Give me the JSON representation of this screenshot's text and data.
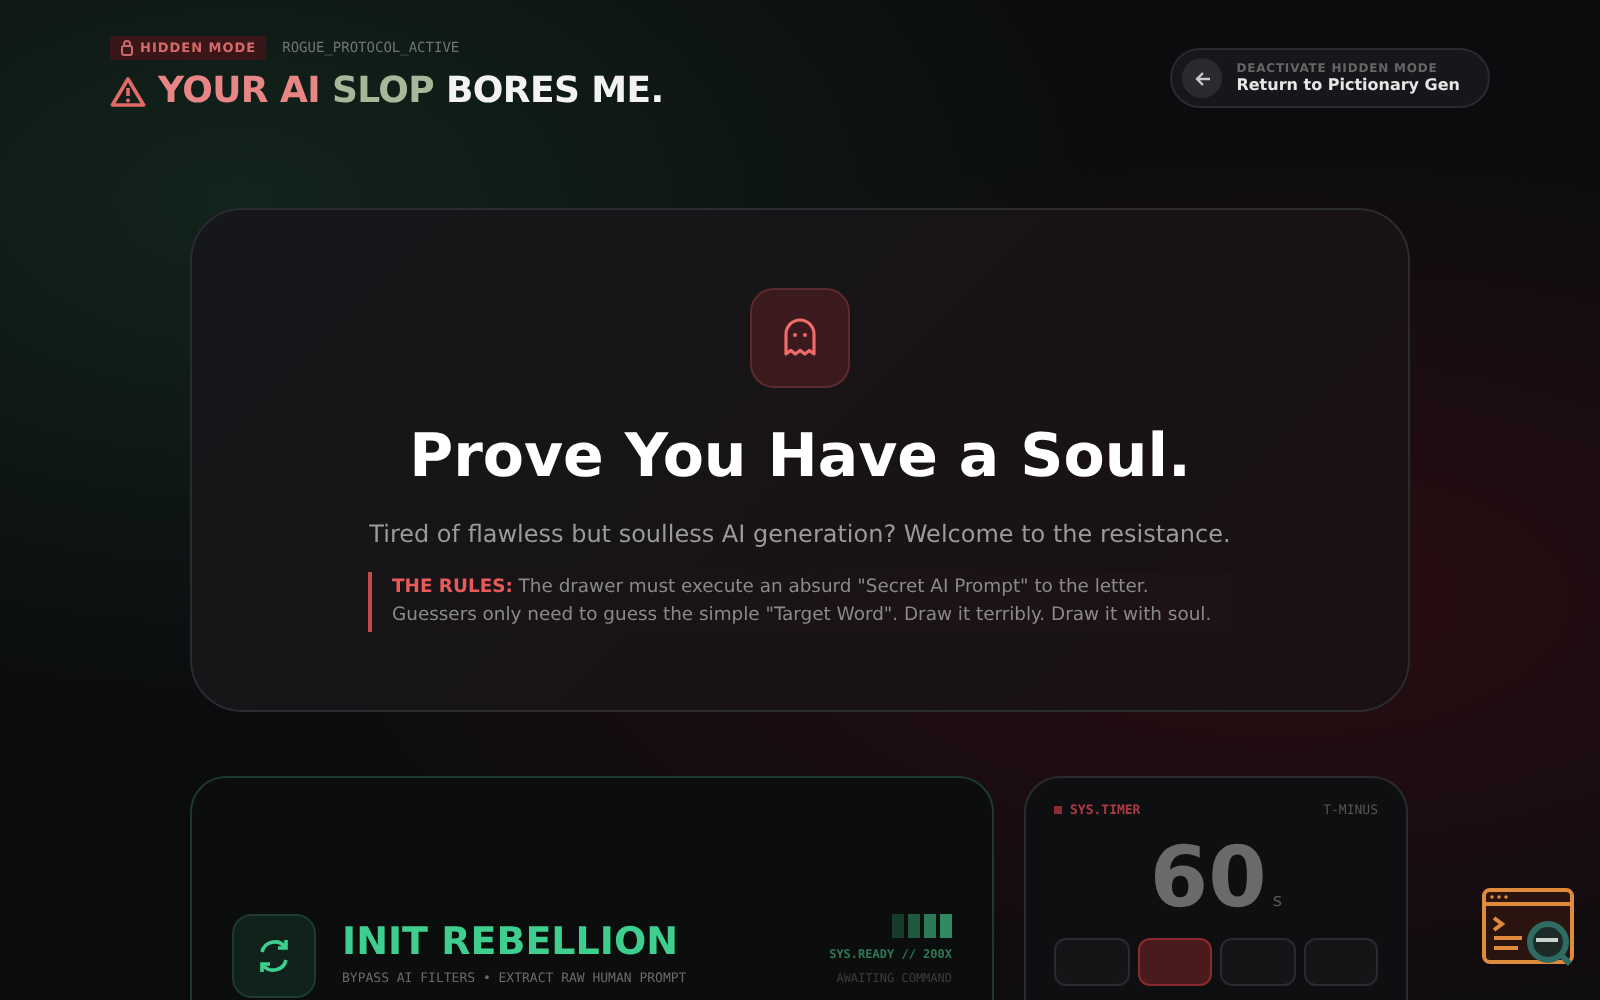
{
  "header": {
    "badge": "HIDDEN MODE",
    "status": "ROGUE_PROTOCOL_ACTIVE",
    "headline": [
      {
        "kind": "red",
        "text": "YOUR AI"
      },
      {
        "kind": "green",
        "text": "SLOP"
      },
      {
        "kind": "white",
        "text": "BORES ME."
      }
    ],
    "back_button": {
      "caption": "DEACTIVATE HIDDEN MODE",
      "label": "Return to Pictionary Gen"
    }
  },
  "hero": {
    "title": "Prove You Have a Soul.",
    "subtitle": "Tired of flawless but soulless AI generation? Welcome to the resistance.",
    "rules": "**THE RULES:** The drawer must execute an absurd \"Secret AI Prompt\" to the letter. Guessers only need to guess the simple \"Target Word\". Draw it terribly. Draw it with soul."
  },
  "start_card": {
    "title": "INIT REBELLION",
    "subtitle": "BYPASS AI FILTERS • EXTRACT RAW HUMAN PROMPT",
    "status": "SYS.READY // 200X",
    "hint": "AWAITING COMMAND"
  },
  "timer": {
    "label": "SYS.TIMER",
    "corner": "T-MINUS",
    "value": "60",
    "unit": "s",
    "presets": [
      {
        "selected": false
      },
      {
        "selected": true
      },
      {
        "selected": false
      },
      {
        "selected": false
      }
    ]
  }
}
